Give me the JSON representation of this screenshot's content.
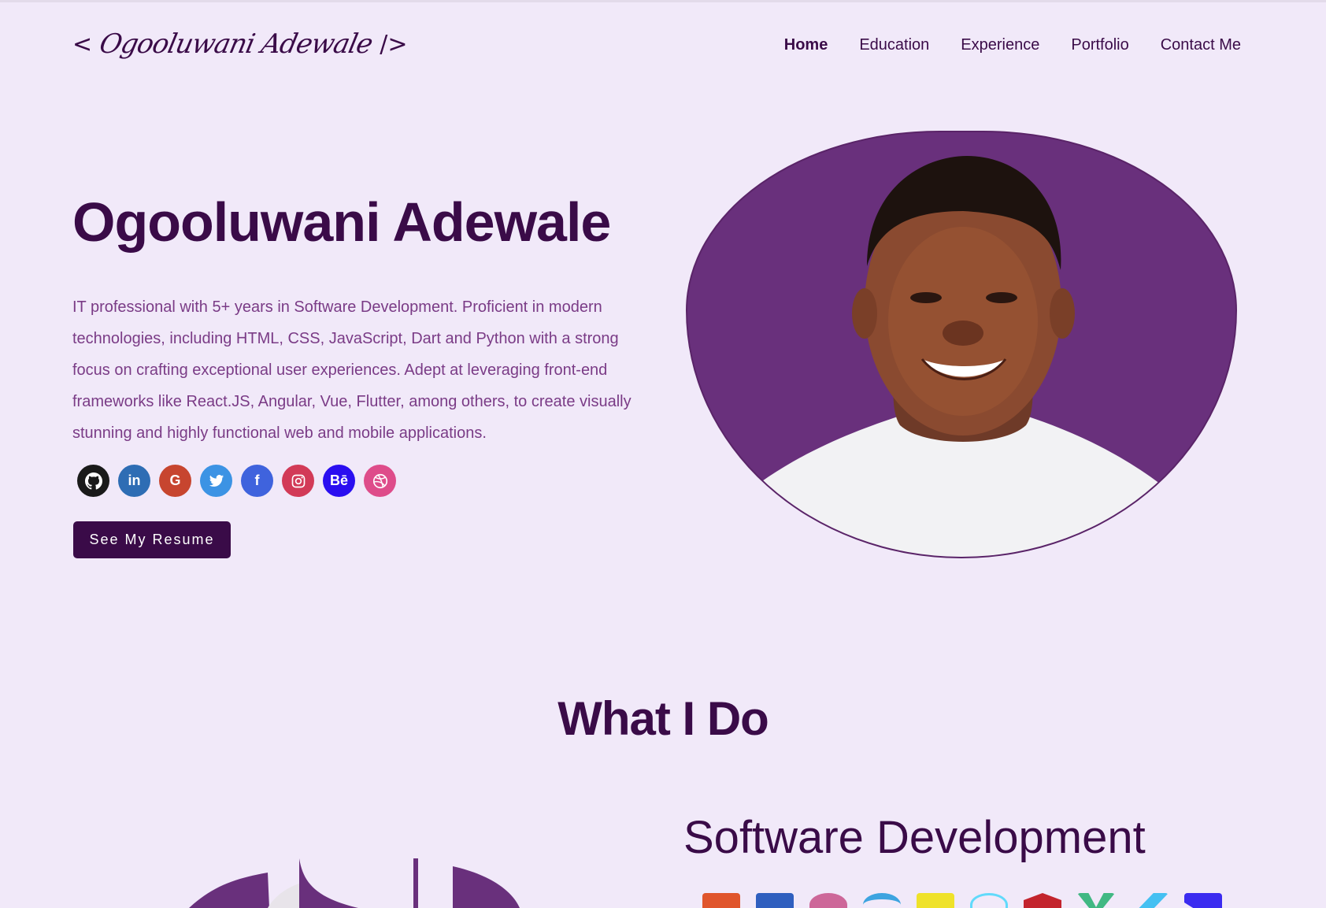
{
  "header": {
    "logo_open": "<",
    "logo_name": "Ogooluwani Adewale",
    "logo_close": "/>",
    "nav": [
      {
        "label": "Home"
      },
      {
        "label": "Education"
      },
      {
        "label": "Experience"
      },
      {
        "label": "Portfolio"
      },
      {
        "label": "Contact Me"
      }
    ],
    "active_nav": "Home"
  },
  "hero": {
    "name": "Ogooluwani Adewale",
    "description": "IT professional with 5+ years in Software Development. Proficient in modern technologies, including HTML, CSS, JavaScript, Dart and Python with a strong focus on crafting exceptional user experiences. Adept at leveraging front-end frameworks like React.JS, Angular, Vue, Flutter, among others, to create visually stunning and highly functional web and mobile applications.",
    "resume_button": "See My Resume",
    "socials": [
      {
        "name": "github-icon",
        "glyph": "",
        "color": "#1a1a1a"
      },
      {
        "name": "linkedin-icon",
        "glyph": "in",
        "color": "#2e6db4"
      },
      {
        "name": "google-icon",
        "glyph": "G",
        "color": "#c7452f"
      },
      {
        "name": "twitter-icon",
        "glyph": "",
        "color": "#3c93e4"
      },
      {
        "name": "facebook-icon",
        "glyph": "f",
        "color": "#3f63dd"
      },
      {
        "name": "instagram-icon",
        "glyph": "",
        "color": "#d23a57"
      },
      {
        "name": "behance-icon",
        "glyph": "Bē",
        "color": "#2a0ef0"
      },
      {
        "name": "dribbble-icon",
        "glyph": "",
        "color": "#de4c8a"
      }
    ]
  },
  "what_i_do": {
    "title": "What I Do",
    "skill_title": "Software Development",
    "tech_icons": [
      {
        "name": "html5-icon",
        "color": "#e0552c"
      },
      {
        "name": "css3-icon",
        "color": "#2f5fbf"
      },
      {
        "name": "sass-icon",
        "color": "#cd6799"
      },
      {
        "name": "dart-icon",
        "color": "#3da4e0"
      },
      {
        "name": "javascript-icon",
        "color": "#efe22a"
      },
      {
        "name": "react-icon",
        "color": "#61dafb"
      },
      {
        "name": "angular-icon",
        "color": "#c3242d"
      },
      {
        "name": "vue-icon",
        "color": "#41b883"
      },
      {
        "name": "flutter-icon",
        "color": "#45c0f2"
      },
      {
        "name": "framer-icon",
        "color": "#3b2bf0"
      }
    ]
  },
  "colors": {
    "background": "#f1e9f9",
    "primary": "#3a0b48",
    "accent": "#69307c",
    "text_muted": "#7a3b86"
  }
}
